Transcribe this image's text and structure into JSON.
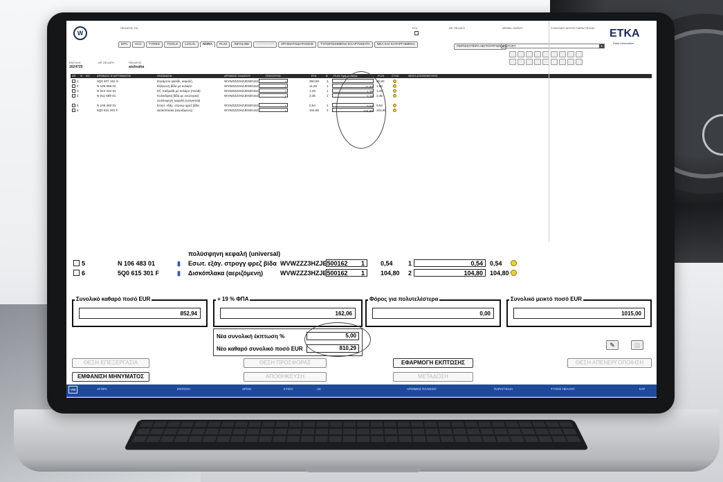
{
  "header": {
    "customer_label": "ΠΕΛΑΤΗΣ ΟΧ",
    "etk_label": "ΕΤΚ",
    "customer2_label": "ΑΡ. ΠΕΛΑΤΗ",
    "order_label": "ΑΡΙΘΜ. ΠΑΡΑΓΓ.",
    "brand_title": "ETKA",
    "brand_sub": "Parts information",
    "mode_label": "ΣΥΝΟΛΙΚΟ ΔΕΛΤΙΟ ΠΑΡΑΓΓΕΛΙΑΣ"
  },
  "tabs": [
    {
      "label": "EPC"
    },
    {
      "label": "ACC"
    },
    {
      "label": "TYRES"
    },
    {
      "label": "TOOLS"
    },
    {
      "label": "LOCAL"
    },
    {
      "label": "NORA"
    },
    {
      "label": "PL24"
    },
    {
      "label": "INFOLINE"
    },
    {
      "label": "AUTOPART"
    },
    {
      "label": "ΧΡΗΜΑΤΟΔΟΤΗΣΕΙΣ"
    },
    {
      "label": "ΤΥΠΟΠΟΙΗΜΕΝΑ ΕΞΑΡΤΗΜΑΤΑ"
    },
    {
      "label": "ΝΕΑ ΚΑΙ ΚΑΤΑΡΓΗΜΕΝΑ"
    }
  ],
  "more_functions": "ΠΕΡΙΣΣΟΤΕΡΑ ΛΕΙΤΟΥΡΓΙΕΣ ▸",
  "report_select": "REPORT",
  "meta": {
    "date_label": "ΕΝΤΟΛΗ",
    "date": "1624725",
    "cust_label": "ΑΡ. ΠΕΛΑΤΗ",
    "name_label": "ΠΕΛΑΤΗΣ",
    "name": "andreaha"
  },
  "grid": {
    "headers": [
      "ΑΡ.",
      "Ψ",
      "Ψ2",
      "ΑΡΙΘΜΟΣ ΕΞΑΡΤΗΜΑΤΟΣ",
      "ΟΝΟΜΑΣΙΑ",
      "ΑΡΙΘΜΟΣ ΠΛΑΙΣΙΟΥ",
      "ΠΟΣΟΤΗΤΑ",
      "ΕΤΑ",
      "Β",
      "PL24 Τιμή μονάδας",
      "PL24",
      "ΣΤΟΚ",
      "ΘΕΣΗ ΑΠΟΘΗΚΕΥΣΗΣ"
    ],
    "rows": [
      {
        "no": "1",
        "part": "3Q0 407 151 S",
        "name": "Εγκάρσιο ψαλίδι, κεφαλή",
        "vin": "WVWZZZ3HZJE500162",
        "qty": "2",
        "eta": "360,80",
        "b": "3",
        "unit": "",
        "pl24": "20,80"
      },
      {
        "no": "2",
        "part": "N  106 959 01",
        "name": "Εξάγωνη βίδα με κολάρο",
        "vin": "WVWZZZ3HZJE500162",
        "qty": "2",
        "eta": "11,90",
        "b": "1",
        "unit": "11,90",
        "pl24": "1,80"
      },
      {
        "no": "3",
        "part": "N  912 332 01",
        "name": "Εξ. παξιμάδι με κολάρο (mvs8)",
        "vin": "WVWZZZ3HZJE500162",
        "qty": "1",
        "eta": "1,25",
        "b": "1",
        "unit": "1,25",
        "pl24": "1,25"
      },
      {
        "no": "4",
        "part": "N  911 689 01",
        "name": "Κυλινδρική βίδα με εσωτερική",
        "vin": "WVWZZZ3HZJE500162",
        "qty": "1",
        "eta": "3,35",
        "b": "1",
        "unit": "3,35",
        "pl24": "3,35"
      },
      {
        "no": "",
        "part": "",
        "name": "πολύσφηνη κεφαλή (universal)",
        "vin": "",
        "qty": "",
        "eta": "",
        "b": "",
        "unit": "",
        "pl24": ""
      },
      {
        "no": "5",
        "part": "N  106 483 01",
        "name": "Εσωτ. εξάγ. στρογγ φρεζ βίδα",
        "vin": "WVWZZZ3HZJE500162",
        "qty": "1",
        "eta": "0,54",
        "b": "1",
        "unit": "0,54",
        "pl24": "0,54"
      },
      {
        "no": "6",
        "part": "5Q0 615 301 F",
        "name": "Δισκόπλακα (αεριζόμενη)",
        "vin": "WVWZZZ3HZJE500162",
        "qty": "1",
        "eta": "104,80",
        "b": "2",
        "unit": "104,80",
        "pl24": "104,80"
      }
    ]
  },
  "zoom": {
    "cont": "πολύσφηνη κεφαλή (universal)",
    "rows": [
      {
        "no": "5",
        "part": "N  106 483 01",
        "name": "Εσωτ. εξάγ. στρογγ φρεζ βίδα",
        "vin": "WVWZZZ3HZJE500162",
        "qty": "1",
        "eta": "0,54",
        "b": "1",
        "unit": "0,54",
        "pl24": "0,54"
      },
      {
        "no": "6",
        "part": "5Q0 615 301 F",
        "name": "Δισκόπλακα (αεριζόμενη)",
        "vin": "WVWZZZ3HZJE500162",
        "qty": "1",
        "eta": "104,80",
        "b": "2",
        "unit": "104,80",
        "pl24": "104,80"
      }
    ]
  },
  "totals": {
    "net_label": "Συνολικό καθαρό ποσό EUR",
    "net": "852,94",
    "vat_label": "+ 19 % ΦΠΑ",
    "vat": "162,06",
    "tax_label": "Φόρος για πολυτελέστερα",
    "tax": "0,00",
    "gross_label": "Συνολικό μεικτό ποσό EUR",
    "gross": "1015,00"
  },
  "discount": {
    "pct_label": "Νέα συνολική έκπτωση %",
    "pct": "5,00",
    "net_label": "Νέο καθαρό συνολικό ποσό EUR",
    "net": "810,29"
  },
  "buttons": {
    "edit": "ΘΕΣΗ ΕΠΕΞΕΡΓΑΣΙΑ",
    "offer": "ΘΕΣΗ ΠΡΟΣΦΟΡΑΣ",
    "apply": "ΕΦΑΡΜΟΓΗ ΕΚΠΤΩΣΗΣ",
    "deactivate": "ΘΕΣΗ ΑΠΕΝΕΡΓΟΠΟΙΗΣΗ",
    "messages": "ΕΜΦΑΝΙΣΗ ΜΗΝΥΜΑΤΟΣ",
    "save": "ΑΠΟΘΗΚΕΥΣΗ",
    "send": "ΜΕΤΑΔΟΣΗ"
  },
  "status": {
    "logo": "VW",
    "items": [
      "ΑΓΟΡΑ",
      "ΕΝΤΟΛΗ",
      "ΧΡΟΝ",
      "ΚΤΙΣΗ",
      "ΑΣ",
      "ΑΡΙΘΜΟΣ ΠΛΑΙΣΙΟΥ",
      "ΠΑΡΑΓΓΕΛΙΑ",
      "ΤΥΠΟΣ ΠΕΛΑΤΗ",
      "ΚΑΤ"
    ]
  }
}
